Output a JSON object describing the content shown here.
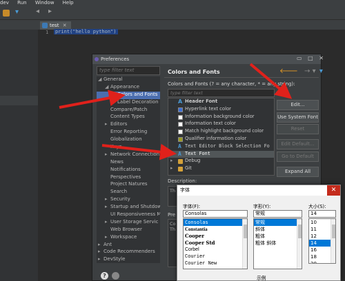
{
  "menubar": {
    "items": [
      "dev",
      "Run",
      "Window",
      "Help"
    ]
  },
  "editor": {
    "tab_label": "test",
    "line_number": "1",
    "code": "print(\"hello python\")"
  },
  "preferences": {
    "title": "Preferences",
    "filter_placeholder": "type filter text",
    "tree": [
      {
        "label": "General",
        "indent": 1,
        "twisty": "◢"
      },
      {
        "label": "Appearance",
        "indent": 2,
        "twisty": "◢"
      },
      {
        "label": "Colors and Fonts",
        "indent": 3,
        "twisty": "",
        "selected": true
      },
      {
        "label": "Label Decoration",
        "indent": 3,
        "twisty": ""
      },
      {
        "label": "Compare/Patch",
        "indent": 2,
        "twisty": ""
      },
      {
        "label": "Content Types",
        "indent": 2,
        "twisty": ""
      },
      {
        "label": "Editors",
        "indent": 2,
        "twisty": "▸"
      },
      {
        "label": "Error Reporting",
        "indent": 2,
        "twisty": ""
      },
      {
        "label": "Globalization",
        "indent": 2,
        "twisty": ""
      },
      {
        "label": "Keys",
        "indent": 2,
        "twisty": ""
      },
      {
        "label": "Network Connection",
        "indent": 2,
        "twisty": "▸"
      },
      {
        "label": "News",
        "indent": 2,
        "twisty": ""
      },
      {
        "label": "Notifications",
        "indent": 2,
        "twisty": ""
      },
      {
        "label": "Perspectives",
        "indent": 2,
        "twisty": ""
      },
      {
        "label": "Project Natures",
        "indent": 2,
        "twisty": ""
      },
      {
        "label": "Search",
        "indent": 2,
        "twisty": ""
      },
      {
        "label": "Security",
        "indent": 2,
        "twisty": "▸"
      },
      {
        "label": "Startup and Shutdown",
        "indent": 2,
        "twisty": "▸"
      },
      {
        "label": "UI Responsiveness M",
        "indent": 2,
        "twisty": ""
      },
      {
        "label": "User Storage Servic",
        "indent": 2,
        "twisty": "▸"
      },
      {
        "label": "Web Browser",
        "indent": 2,
        "twisty": ""
      },
      {
        "label": "Workspace",
        "indent": 2,
        "twisty": "▸"
      },
      {
        "label": "Ant",
        "indent": 1,
        "twisty": "▸"
      },
      {
        "label": "Code Recommenders",
        "indent": 1,
        "twisty": "▸"
      },
      {
        "label": "DevStyle",
        "indent": 1,
        "twisty": "▸"
      }
    ],
    "page_title": "Colors and Fonts",
    "page_description": "Colors and Fonts (? = any character, * = any string):",
    "cf_filter_placeholder": "type filter text",
    "cf_items": [
      {
        "label": "Header Font",
        "icon": "font",
        "style": "bold"
      },
      {
        "label": "Hyperlink text color",
        "icon": "swatch-blue"
      },
      {
        "label": "Information background color",
        "icon": "swatch-white"
      },
      {
        "label": "Information text color",
        "icon": "swatch-white"
      },
      {
        "label": "Match highlight background color",
        "icon": "swatch-white"
      },
      {
        "label": "Qualifier information color",
        "icon": "swatch-olive"
      },
      {
        "label": "Text Editor Block Selection Fo",
        "icon": "font",
        "style": "mono"
      },
      {
        "label": "Text Font",
        "icon": "font",
        "style": "mono",
        "selected": true
      },
      {
        "label": "Debug",
        "icon": "folder",
        "folder": true
      },
      {
        "label": "Git",
        "icon": "folder",
        "folder": true
      }
    ],
    "buttons": {
      "edit": "Edit...",
      "use_system_font": "Use System Font",
      "reset": "Reset",
      "edit_default": "Edit Default...",
      "go_to_default": "Go to Default",
      "expand_all": "Expand All"
    },
    "description_label": "Description:",
    "description_text": "Th",
    "preview_label": "Pre",
    "preview_text": "Co Th"
  },
  "font_dialog": {
    "title": "字体",
    "font_label": "字体(F):",
    "font_value": "Consolas",
    "fonts": [
      "Consolas",
      "Constantia",
      "Cooper",
      "Cooper Std",
      "Corbel",
      "Courier",
      "Courier New"
    ],
    "style_label": "字形(Y):",
    "style_value": "常规",
    "styles": [
      "常规",
      "斜体",
      "粗体",
      "粗体 斜体"
    ],
    "size_label": "大小(S):",
    "size_value": "14",
    "sizes": [
      "10",
      "11",
      "12",
      "14",
      "16",
      "18",
      "20"
    ],
    "sample_label": "示例"
  },
  "colors": {
    "selection": "#4b6eaf",
    "font_dialog_selection": "#0078d7",
    "arrow": "#e0211b"
  }
}
